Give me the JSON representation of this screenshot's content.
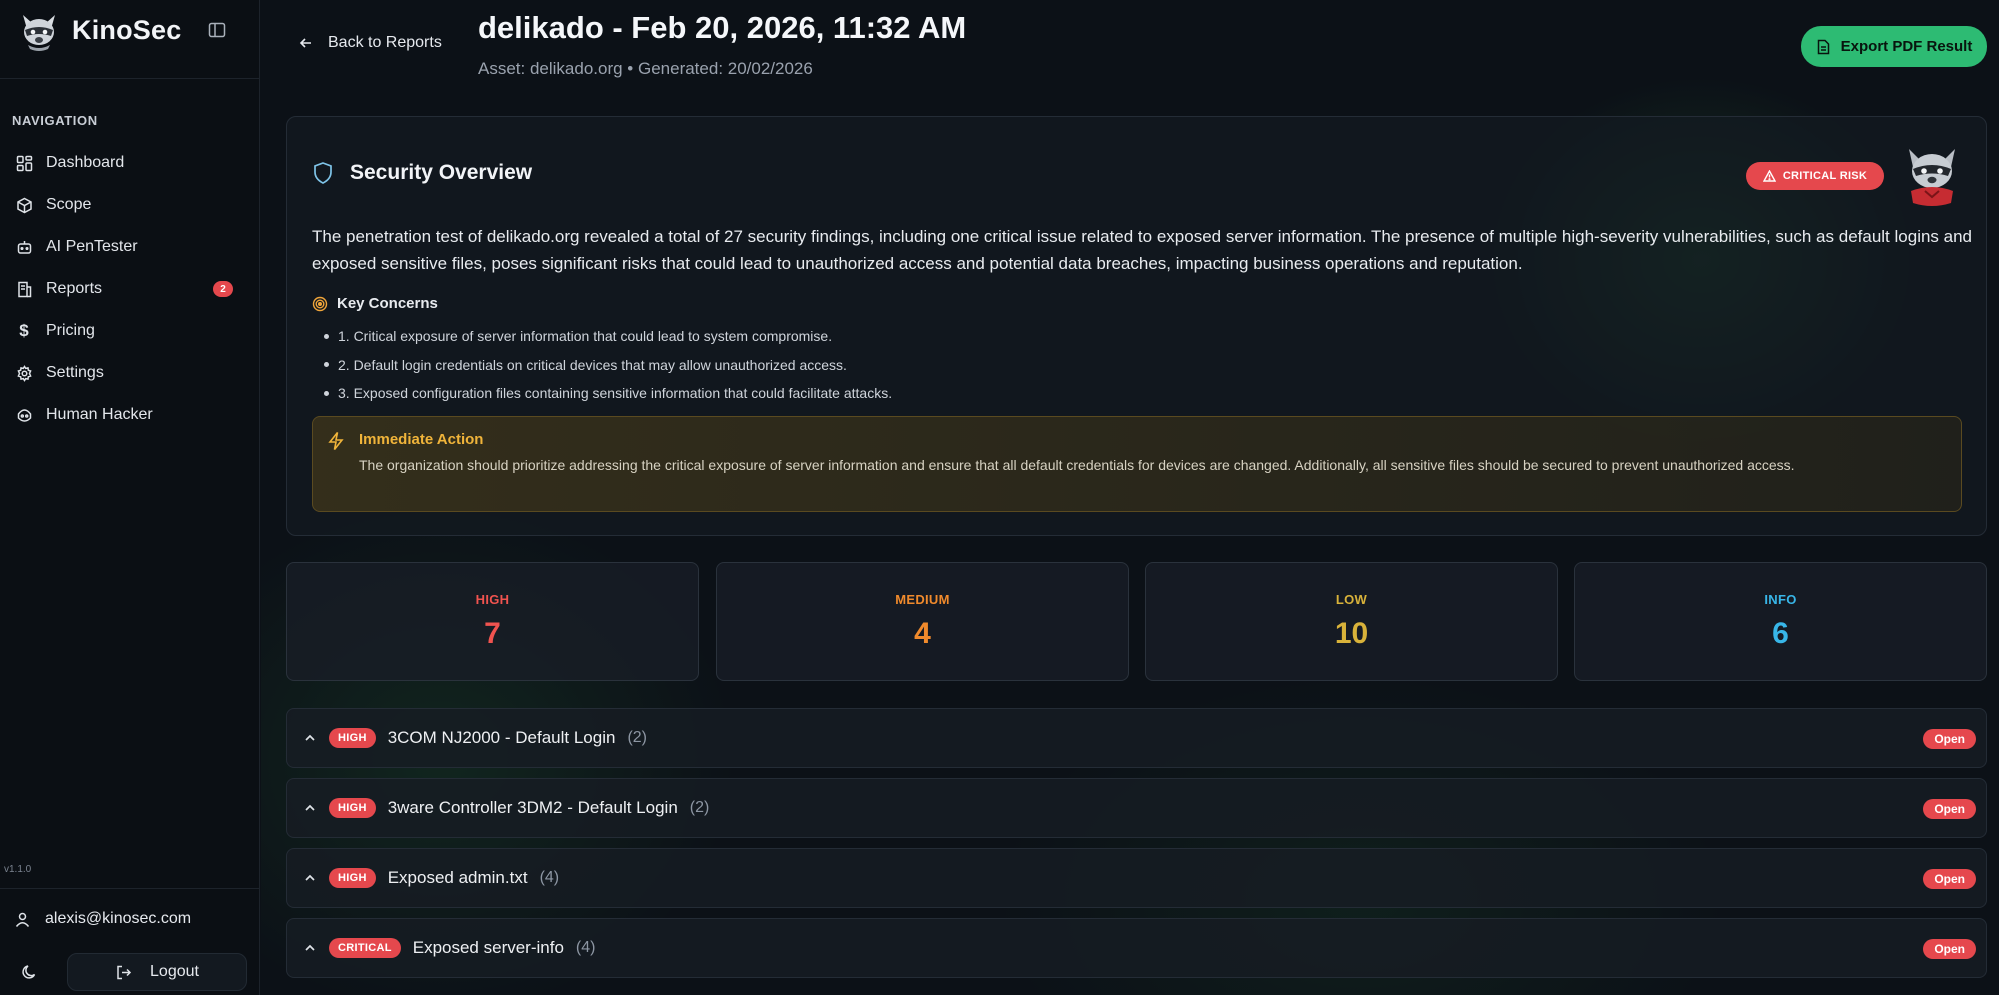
{
  "app": {
    "name": "KinoSec",
    "version": "v1.1.0"
  },
  "sidebar": {
    "heading": "NAVIGATION",
    "items": [
      {
        "label": "Dashboard",
        "icon": "dashboard-icon"
      },
      {
        "label": "Scope",
        "icon": "cube-icon"
      },
      {
        "label": "AI PenTester",
        "icon": "bot-icon"
      },
      {
        "label": "Reports",
        "icon": "reports-icon",
        "badge": "2"
      },
      {
        "label": "Pricing",
        "icon": "dollar-icon"
      },
      {
        "label": "Settings",
        "icon": "gear-icon"
      },
      {
        "label": "Human Hacker",
        "icon": "hacker-icon"
      }
    ],
    "user": {
      "email": "alexis@kinosec.com"
    },
    "logout_label": "Logout"
  },
  "header": {
    "back_label": "Back to Reports",
    "title": "delikado - Feb 20, 2026, 11:32 AM",
    "subtitle": "Asset: delikado.org • Generated: 20/02/2026",
    "export_label": "Export PDF Result"
  },
  "overview": {
    "title": "Security Overview",
    "risk_badge": "CRITICAL RISK",
    "summary": "The penetration test of delikado.org revealed a total of 27 security findings, including one critical issue related to exposed server information. The presence of multiple high-severity vulnerabilities, such as default logins and exposed sensitive files, poses significant risks that could lead to unauthorized access and potential data breaches, impacting business operations and reputation.",
    "concerns_title": "Key Concerns",
    "concerns": [
      "1. Critical exposure of server information that could lead to system compromise.",
      "2. Default login credentials on critical devices that may allow unauthorized access.",
      "3. Exposed configuration files containing sensitive information that could facilitate attacks."
    ],
    "action_title": "Immediate Action",
    "action_text": "The organization should prioritize addressing the critical exposure of server information and ensure that all default credentials for devices are changed. Additionally, all sensitive files should be secured to prevent unauthorized access."
  },
  "stats": [
    {
      "label": "HIGH",
      "value": "7",
      "color": "#f0534f"
    },
    {
      "label": "MEDIUM",
      "value": "4",
      "color": "#f08a2c"
    },
    {
      "label": "LOW",
      "value": "10",
      "color": "#d8b23a"
    },
    {
      "label": "INFO",
      "value": "6",
      "color": "#38b6e8"
    }
  ],
  "findings": [
    {
      "severity": "HIGH",
      "title": "3COM NJ2000 - Default Login",
      "count": "(2)",
      "status": "Open"
    },
    {
      "severity": "HIGH",
      "title": "3ware Controller 3DM2 - Default Login",
      "count": "(2)",
      "status": "Open"
    },
    {
      "severity": "HIGH",
      "title": "Exposed admin.txt",
      "count": "(4)",
      "status": "Open"
    },
    {
      "severity": "CRITICAL",
      "title": "Exposed server-info",
      "count": "(4)",
      "status": "Open"
    }
  ],
  "colors": {
    "accent_green": "#2dbb73",
    "danger": "#e5484d",
    "warning": "#f0b43a"
  }
}
